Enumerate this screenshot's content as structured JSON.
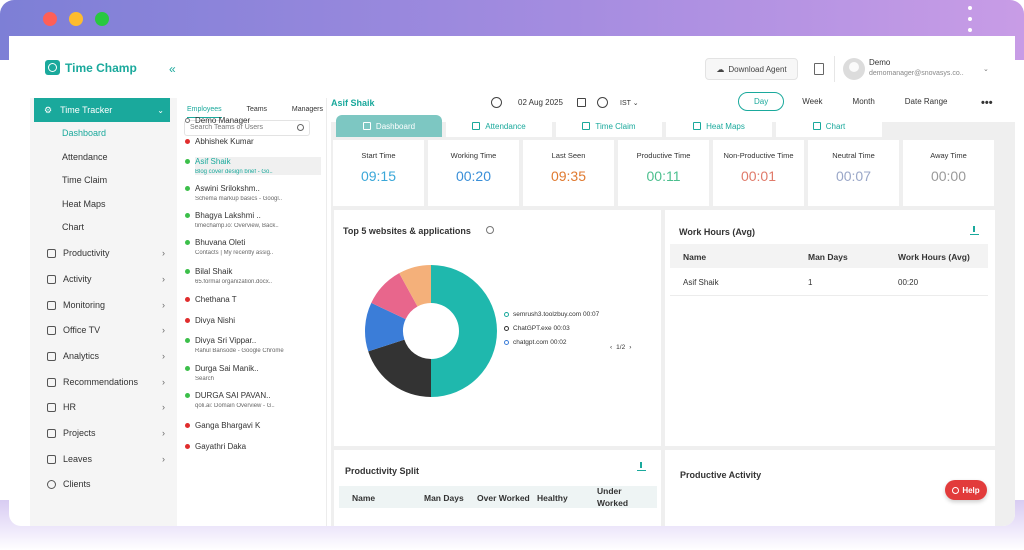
{
  "app": {
    "name": "Time Champ"
  },
  "header": {
    "download_label": "Download Agent",
    "user_name": "Demo",
    "user_email": "demomanager@snovasys.co..",
    "collapse_glyph": "«"
  },
  "sidebar": {
    "active_section": "Time Tracker",
    "sub_items": [
      "Dashboard",
      "Attendance",
      "Time Claim",
      "Heat Maps",
      "Chart"
    ],
    "items": [
      "Productivity",
      "Activity",
      "Monitoring",
      "Office TV",
      "Analytics",
      "Recommendations",
      "HR",
      "Projects",
      "Leaves",
      "Clients"
    ]
  },
  "employees": {
    "tabs": [
      "Employees",
      "Teams",
      "Managers"
    ],
    "search_placeholder": "Search Teams or Users",
    "list": [
      {
        "name": "Demo Manager",
        "status": "none",
        "activity": ""
      },
      {
        "name": "Abhishek Kumar",
        "status": "offline",
        "activity": ""
      },
      {
        "name": "Asif Shaik",
        "status": "online",
        "activity": "Blog cover design brief - Go.."
      },
      {
        "name": "Aswini Srilokshm..",
        "status": "online",
        "activity": "Schema markup basics - Googl.."
      },
      {
        "name": "Bhagya Lakshmi ..",
        "status": "online",
        "activity": "timechamp.io: Overview, Back.."
      },
      {
        "name": "Bhuvana Oleti",
        "status": "online",
        "activity": "Contacts | My recently assig.."
      },
      {
        "name": "Bilal Shaik",
        "status": "online",
        "activity": "65.formal organization.docx.."
      },
      {
        "name": "Chethana T",
        "status": "offline",
        "activity": ""
      },
      {
        "name": "Divya Nishi",
        "status": "offline",
        "activity": ""
      },
      {
        "name": "Divya Sri Vippar..",
        "status": "online",
        "activity": "Rahul Bansode - Google Chrome"
      },
      {
        "name": "Durga Sai Manik..",
        "status": "online",
        "activity": "Search"
      },
      {
        "name": "DURGA SAI PAVAN..",
        "status": "online",
        "activity": "qoli.ai: Domain Overview - G.."
      },
      {
        "name": "Ganga Bhargavi K",
        "status": "offline",
        "activity": ""
      },
      {
        "name": "Gayathri Daka",
        "status": "offline",
        "activity": ""
      }
    ]
  },
  "toolbar": {
    "person": "Asif Shaik",
    "date": "02 Aug 2025",
    "timezone": "IST",
    "ranges": [
      "Day",
      "Week",
      "Month",
      "Date Range"
    ],
    "active_range": "Day"
  },
  "tabs": [
    "Dashboard",
    "Attendance",
    "Time Claim",
    "Heat Maps",
    "Chart"
  ],
  "stats": [
    {
      "label": "Start Time",
      "value": "09:15",
      "color": "#3aa7d8"
    },
    {
      "label": "Working Time",
      "value": "00:20",
      "color": "#3a8fd8"
    },
    {
      "label": "Last Seen",
      "value": "09:35",
      "color": "#e07a30"
    },
    {
      "label": "Productive Time",
      "value": "00:11",
      "color": "#4cbf8e"
    },
    {
      "label": "Non-Productive Time",
      "value": "00:01",
      "color": "#e07a6a"
    },
    {
      "label": "Neutral Time",
      "value": "00:07",
      "color": "#9aa7c8"
    },
    {
      "label": "Away Time",
      "value": "00:00",
      "color": "#9a9a9a"
    }
  ],
  "top_sites": {
    "title": "Top 5 websites & applications",
    "legend": [
      {
        "label": "semrush3.toolzbuy.com 00:07",
        "color": "#1aa99c"
      },
      {
        "label": "ChatGPT.exe 00:03",
        "color": "#333333"
      },
      {
        "label": "chatgpt.com 00:02",
        "color": "#3b7dd8"
      }
    ],
    "pager": "1/2",
    "slices": [
      {
        "value": 50,
        "color": "#1fb8ad"
      },
      {
        "value": 20,
        "color": "#333333"
      },
      {
        "value": 12,
        "color": "#3b7dd8"
      },
      {
        "value": 10,
        "color": "#e8668c"
      },
      {
        "value": 8,
        "color": "#f4b07a"
      }
    ]
  },
  "work_hours": {
    "title": "Work Hours (Avg)",
    "columns": [
      "Name",
      "Man Days",
      "Work Hours (Avg)"
    ],
    "rows": [
      [
        "Asif Shaik",
        "1",
        "00:20"
      ]
    ]
  },
  "productivity_split": {
    "title": "Productivity Split",
    "columns": [
      "Name",
      "Man Days",
      "Over Worked",
      "Healthy",
      "Under Worked"
    ]
  },
  "productive_activity": {
    "title": "Productive Activity"
  },
  "help_label": "Help"
}
